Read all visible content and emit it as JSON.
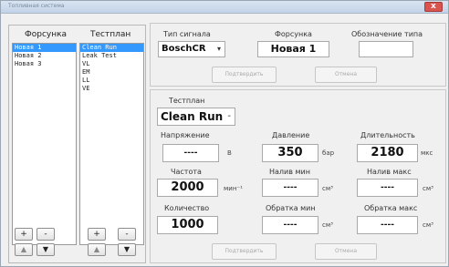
{
  "window": {
    "title": "Топливная система"
  },
  "left": {
    "injector_header": "Форсунка",
    "testplan_header": "Тестплан",
    "injectors": [
      "Новая 1",
      "Новая 2",
      "Новая 3"
    ],
    "testplans": [
      "Clean Run",
      "Leak Test",
      "VL",
      "EM",
      "LL",
      "VE"
    ],
    "selected_injector": 0,
    "selected_testplan": 0,
    "buttons": {
      "plus": "+",
      "minus": "-",
      "up": "▲",
      "down": "▼"
    }
  },
  "top": {
    "signal_type_label": "Тип сигнала",
    "signal_type_value": "BoschCR",
    "injector_label": "Форсунка",
    "injector_value": "Новая 1",
    "type_designation_label": "Обозначение типа",
    "type_designation_value": "",
    "confirm_button": "Подтвердить",
    "cancel_button": "Отмена"
  },
  "bottom": {
    "testplan_label": "Тестплан",
    "testplan_value": "Clean Run",
    "voltage_label": "Напряжение",
    "voltage_value": "----",
    "voltage_unit": "В",
    "pressure_label": "Давление",
    "pressure_value": "350",
    "pressure_unit": "бар",
    "duration_label": "Длительность",
    "duration_value": "2180",
    "duration_unit": "мкс",
    "frequency_label": "Частота",
    "frequency_value": "2000",
    "frequency_unit": "мин⁻¹",
    "fill_min_label": "Налив мин",
    "fill_min_value": "----",
    "fill_min_unit": "см³",
    "fill_max_label": "Налив макс",
    "fill_max_value": "----",
    "fill_max_unit": "см³",
    "count_label": "Количество",
    "count_value": "1000",
    "return_min_label": "Обратка мин",
    "return_min_value": "----",
    "return_min_unit": "см³",
    "return_max_label": "Обратка макс",
    "return_max_value": "----",
    "return_max_unit": "см³",
    "confirm_button": "Подтвердить",
    "cancel_button": "Отмена"
  }
}
